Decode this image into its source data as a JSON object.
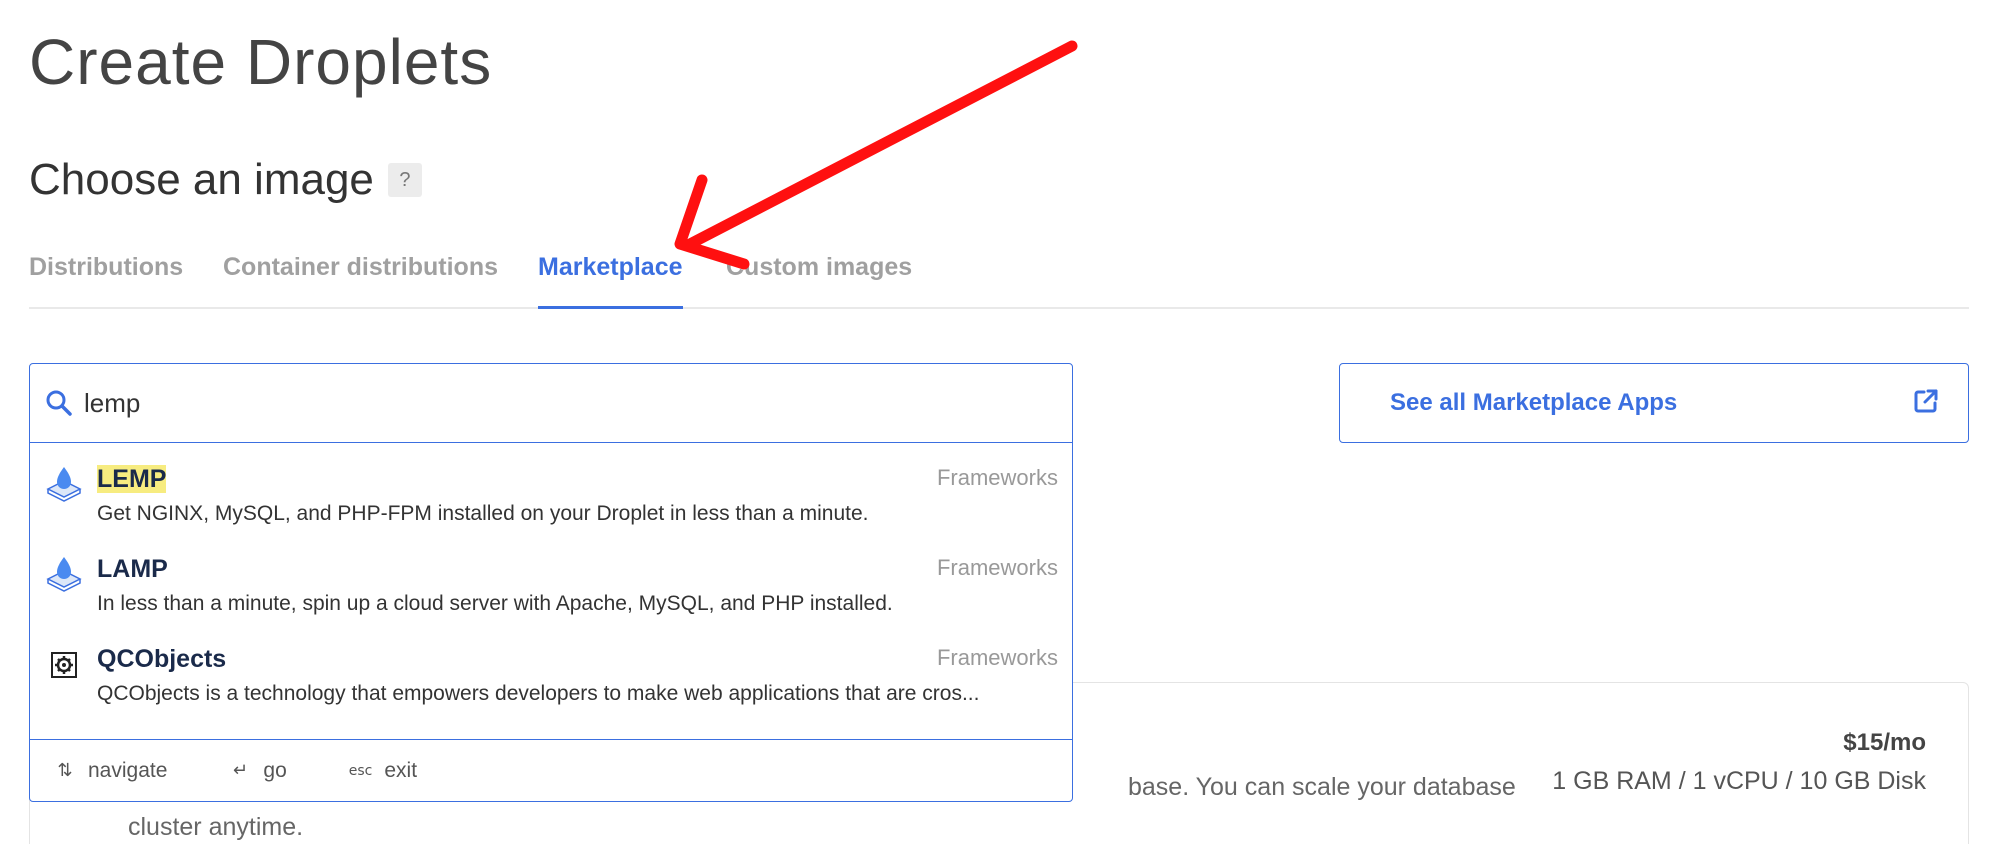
{
  "page_title": "Create Droplets",
  "section": {
    "title": "Choose an image",
    "help": "?"
  },
  "tabs": [
    {
      "label": "Distributions"
    },
    {
      "label": "Container distributions"
    },
    {
      "label": "Marketplace"
    },
    {
      "label": "Custom images"
    }
  ],
  "search": {
    "value": "lemp"
  },
  "results": [
    {
      "name": "LEMP",
      "category": "Frameworks",
      "description": "Get NGINX, MySQL, and PHP-FPM installed on your Droplet in less than a minute.",
      "icon": "droplet-stack-icon"
    },
    {
      "name": "LAMP",
      "category": "Frameworks",
      "description": "In less than a minute, spin up a cloud server with Apache, MySQL, and PHP installed.",
      "icon": "droplet-stack-icon"
    },
    {
      "name": "QCObjects",
      "category": "Frameworks",
      "description": "QCObjects is a technology that empowers developers to make web applications that are cros...",
      "icon": "gear-icon"
    }
  ],
  "footer_hints": [
    {
      "icon": "⇅",
      "label": "navigate"
    },
    {
      "icon": "↵",
      "label": "go"
    },
    {
      "icon": "esc",
      "label": "exit"
    }
  ],
  "marketplace_button": {
    "label": "See all Marketplace Apps",
    "icon": "external-link-icon"
  },
  "background_card": {
    "price": "$15/mo",
    "specs": "1 GB RAM / 1 vCPU / 10 GB Disk",
    "desc_visible": "base. You can scale your database",
    "desc_line2": "cluster anytime."
  },
  "colors": {
    "accent": "#3b6fe0",
    "highlight": "#f7ec80",
    "annotation_arrow": "#ff0000"
  }
}
